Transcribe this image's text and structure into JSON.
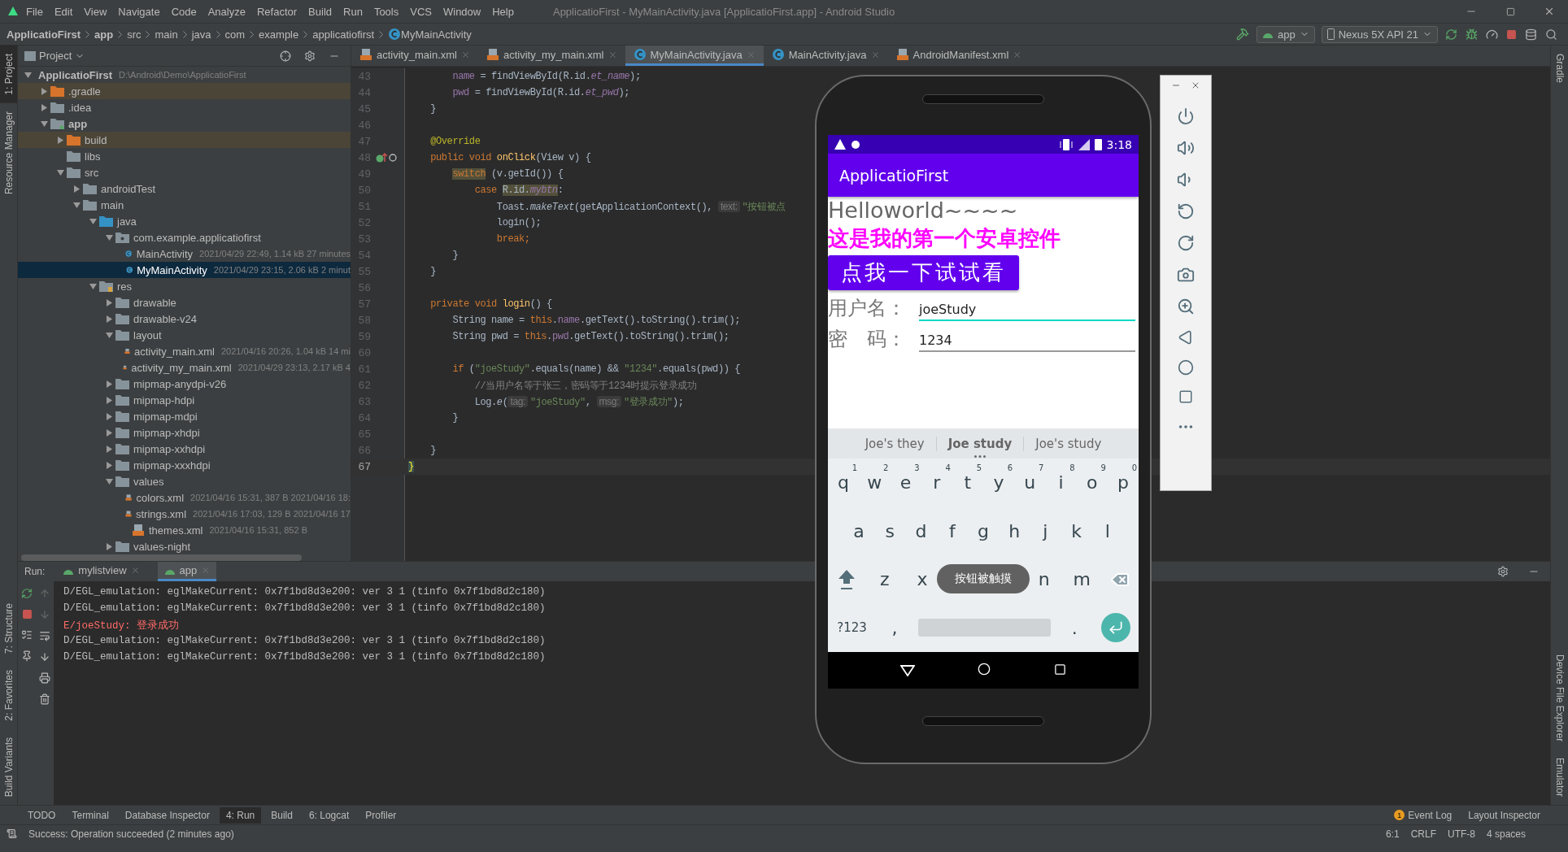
{
  "window": {
    "title": "ApplicatioFirst - MyMainActivity.java [ApplicatioFirst.app] - Android Studio"
  },
  "menu": [
    "File",
    "Edit",
    "View",
    "Navigate",
    "Code",
    "Analyze",
    "Refactor",
    "Build",
    "Run",
    "Tools",
    "VCS",
    "Window",
    "Help"
  ],
  "breadcrumb": [
    {
      "label": "ApplicatioFirst",
      "kind": "project"
    },
    {
      "label": "app",
      "kind": "module"
    },
    {
      "label": "src",
      "kind": "dir"
    },
    {
      "label": "main",
      "kind": "dir"
    },
    {
      "label": "java",
      "kind": "dir"
    },
    {
      "label": "com",
      "kind": "dir"
    },
    {
      "label": "example",
      "kind": "dir"
    },
    {
      "label": "applicatiofirst",
      "kind": "dir"
    },
    {
      "label": "MyMainActivity",
      "kind": "class"
    }
  ],
  "toolbar": {
    "run_config": "app",
    "device": "Nexus 5X API 21"
  },
  "left_stripe": {
    "top": [
      {
        "label": "1: Project",
        "selected": true
      },
      {
        "label": "Resource Manager",
        "selected": false
      }
    ],
    "bottom": [
      {
        "label": "7: Structure",
        "selected": false
      },
      {
        "label": "2: Favorites",
        "selected": false
      },
      {
        "label": "Build Variants",
        "selected": false
      }
    ]
  },
  "right_stripe": {
    "top": [
      {
        "label": "Gradle"
      }
    ],
    "bottom": [
      {
        "label": "Device File Explorer"
      },
      {
        "label": "Emulator"
      }
    ]
  },
  "project": {
    "title": "Project",
    "tree": [
      {
        "label": "ApplicatioFirst",
        "kind": "project",
        "meta": "D:\\Android\\Demo\\ApplicatioFirst",
        "expanded": true,
        "selected": false,
        "children": [
          {
            "label": ".gradle",
            "kind": "excluded",
            "expanded": false,
            "selected": false
          },
          {
            "label": ".idea",
            "kind": "folder",
            "expanded": false,
            "selected": false
          },
          {
            "label": "app",
            "kind": "module",
            "expanded": true,
            "selected": false,
            "children": [
              {
                "label": "build",
                "kind": "excluded",
                "expanded": false,
                "selected": false
              },
              {
                "label": "libs",
                "kind": "folder",
                "selected": false
              },
              {
                "label": "src",
                "kind": "folder",
                "expanded": true,
                "selected": false,
                "children": [
                  {
                    "label": "androidTest",
                    "kind": "folder",
                    "expanded": false,
                    "selected": false
                  },
                  {
                    "label": "main",
                    "kind": "folder",
                    "expanded": true,
                    "selected": false,
                    "children": [
                      {
                        "label": "java",
                        "kind": "source",
                        "expanded": true,
                        "selected": false,
                        "children": [
                          {
                            "label": "com.example.applicatiofirst",
                            "kind": "package",
                            "expanded": true,
                            "selected": false,
                            "children": [
                              {
                                "label": "MainActivity",
                                "kind": "class",
                                "meta": "2021/04/29 22:49, 1.14 kB 27 minutes",
                                "selected": false
                              },
                              {
                                "label": "MyMainActivity",
                                "kind": "class",
                                "meta": "2021/04/29 23:15, 2.06 kB 2 minut",
                                "selected": true
                              }
                            ]
                          }
                        ]
                      },
                      {
                        "label": "res",
                        "kind": "resources",
                        "expanded": true,
                        "selected": false,
                        "children": [
                          {
                            "label": "drawable",
                            "kind": "folder",
                            "expanded": false,
                            "selected": false
                          },
                          {
                            "label": "drawable-v24",
                            "kind": "folder",
                            "expanded": false,
                            "selected": false
                          },
                          {
                            "label": "layout",
                            "kind": "folder",
                            "expanded": true,
                            "selected": false,
                            "children": [
                              {
                                "label": "activity_main.xml",
                                "kind": "xml",
                                "meta": "2021/04/16 20:26, 1.04 kB 14 mi",
                                "selected": false
                              },
                              {
                                "label": "activity_my_main.xml",
                                "kind": "xml",
                                "meta": "2021/04/29 23:13, 2.17 kB 4",
                                "selected": false
                              }
                            ]
                          },
                          {
                            "label": "mipmap-anydpi-v26",
                            "kind": "folder",
                            "expanded": false,
                            "selected": false
                          },
                          {
                            "label": "mipmap-hdpi",
                            "kind": "folder",
                            "expanded": false,
                            "selected": false
                          },
                          {
                            "label": "mipmap-mdpi",
                            "kind": "folder",
                            "expanded": false,
                            "selected": false
                          },
                          {
                            "label": "mipmap-xhdpi",
                            "kind": "folder",
                            "expanded": false,
                            "selected": false
                          },
                          {
                            "label": "mipmap-xxhdpi",
                            "kind": "folder",
                            "expanded": false,
                            "selected": false
                          },
                          {
                            "label": "mipmap-xxxhdpi",
                            "kind": "folder",
                            "expanded": false,
                            "selected": false
                          },
                          {
                            "label": "values",
                            "kind": "folder",
                            "expanded": true,
                            "selected": false,
                            "children": [
                              {
                                "label": "colors.xml",
                                "kind": "xml",
                                "meta": "2021/04/16 15:31, 387 B 2021/04/16 18:",
                                "selected": false
                              },
                              {
                                "label": "strings.xml",
                                "kind": "xml",
                                "meta": "2021/04/16 17:03, 129 B 2021/04/16 17",
                                "selected": false
                              },
                              {
                                "label": "themes.xml",
                                "kind": "xml",
                                "meta": "2021/04/16 15:31, 852 B",
                                "selected": false
                              }
                            ]
                          },
                          {
                            "label": "values-night",
                            "kind": "folder",
                            "expanded": false,
                            "selected": false
                          }
                        ]
                      }
                    ]
                  }
                ]
              }
            ]
          }
        ]
      }
    ]
  },
  "editor_tabs": [
    {
      "label": "activity_main.xml",
      "kind": "xml",
      "selected": false
    },
    {
      "label": "activity_my_main.xml",
      "kind": "xml",
      "selected": false
    },
    {
      "label": "MyMainActivity.java",
      "kind": "class",
      "selected": true
    },
    {
      "label": "MainActivity.java",
      "kind": "class",
      "selected": false
    },
    {
      "label": "AndroidManifest.xml",
      "kind": "manifest",
      "selected": false
    }
  ],
  "code": [
    {
      "number": "43",
      "current": false,
      "tokens": [
        {
          "kind": "f",
          "text": "        name"
        },
        {
          "kind": "p",
          "text": " = findViewById(R.id."
        },
        {
          "kind": "fi",
          "text": "et_name"
        },
        {
          "kind": "p",
          "text": ");"
        }
      ]
    },
    {
      "number": "44",
      "current": false,
      "tokens": [
        {
          "kind": "f",
          "text": "        pwd"
        },
        {
          "kind": "p",
          "text": " = findViewById(R.id."
        },
        {
          "kind": "fi",
          "text": "et_pwd"
        },
        {
          "kind": "p",
          "text": ");"
        }
      ]
    },
    {
      "number": "45",
      "current": false,
      "tokens": [
        {
          "kind": "p",
          "text": "    }"
        }
      ]
    },
    {
      "number": "46",
      "current": false
    },
    {
      "number": "47",
      "current": false,
      "tokens": [
        {
          "kind": "a",
          "text": "    @Override"
        }
      ]
    },
    {
      "number": "48",
      "current": false,
      "override_mark": true,
      "tokens": [
        {
          "kind": "k",
          "text": "    public void "
        },
        {
          "kind": "m",
          "text": "onClick"
        },
        {
          "kind": "p",
          "text": "(View v) {"
        }
      ]
    },
    {
      "number": "49",
      "current": false,
      "tokens": [
        {
          "kind": "hk",
          "text": "        switch"
        },
        {
          "kind": "p",
          "text": " (v.getId()) {"
        }
      ]
    },
    {
      "number": "50",
      "current": false,
      "tokens": [
        {
          "kind": "k",
          "text": "            case "
        },
        {
          "kind": "hp",
          "text": "R.id."
        },
        {
          "kind": "hf",
          "text": "mybtn"
        },
        {
          "kind": "p",
          "text": ":"
        }
      ]
    },
    {
      "number": "51",
      "current": false,
      "tokens": [
        {
          "kind": "p",
          "text": "                Toast."
        },
        {
          "kind": "i",
          "text": "makeText"
        },
        {
          "kind": "p",
          "text": "(getApplicationContext(), "
        },
        {
          "kind": "h",
          "text": "text:"
        },
        {
          "kind": "s",
          "text": "\"按钮被点"
        }
      ]
    },
    {
      "number": "52",
      "current": false,
      "tokens": [
        {
          "kind": "p",
          "text": "                login();"
        }
      ]
    },
    {
      "number": "53",
      "current": false,
      "tokens": [
        {
          "kind": "k",
          "text": "                break;"
        }
      ]
    },
    {
      "number": "54",
      "current": false,
      "tokens": [
        {
          "kind": "p",
          "text": "        }"
        }
      ]
    },
    {
      "number": "55",
      "current": false,
      "tokens": [
        {
          "kind": "p",
          "text": "    }"
        }
      ]
    },
    {
      "number": "56",
      "current": false
    },
    {
      "number": "57",
      "current": false,
      "tokens": [
        {
          "kind": "k",
          "text": "    private void "
        },
        {
          "kind": "m",
          "text": "login"
        },
        {
          "kind": "p",
          "text": "() {"
        }
      ]
    },
    {
      "number": "58",
      "current": false,
      "tokens": [
        {
          "kind": "p",
          "text": "        String name = "
        },
        {
          "kind": "k",
          "text": "this"
        },
        {
          "kind": "p",
          "text": "."
        },
        {
          "kind": "f",
          "text": "name"
        },
        {
          "kind": "p",
          "text": ".getText().toString().trim();"
        }
      ]
    },
    {
      "number": "59",
      "current": false,
      "tokens": [
        {
          "kind": "p",
          "text": "        String pwd = "
        },
        {
          "kind": "k",
          "text": "this"
        },
        {
          "kind": "p",
          "text": "."
        },
        {
          "kind": "f",
          "text": "pwd"
        },
        {
          "kind": "p",
          "text": ".getText().toString().trim();"
        }
      ]
    },
    {
      "number": "60",
      "current": false
    },
    {
      "number": "61",
      "current": false,
      "tokens": [
        {
          "kind": "k",
          "text": "        if "
        },
        {
          "kind": "p",
          "text": "("
        },
        {
          "kind": "s",
          "text": "\"joeStudy\""
        },
        {
          "kind": "p",
          "text": ".equals(name) && "
        },
        {
          "kind": "s",
          "text": "\"1234\""
        },
        {
          "kind": "p",
          "text": ".equals(pwd)) {"
        }
      ]
    },
    {
      "number": "62",
      "current": false,
      "tokens": [
        {
          "kind": "c",
          "text": "            //当用户名等于张三，密码等于1234时提示登录成功"
        }
      ]
    },
    {
      "number": "63",
      "current": false,
      "tokens": [
        {
          "kind": "p",
          "text": "            Log."
        },
        {
          "kind": "i",
          "text": "e"
        },
        {
          "kind": "p",
          "text": "("
        },
        {
          "kind": "h",
          "text": "tag:"
        },
        {
          "kind": "s",
          "text": "\"joeStudy\""
        },
        {
          "kind": "p",
          "text": ", "
        },
        {
          "kind": "h",
          "text": "msg:"
        },
        {
          "kind": "s",
          "text": "\"登录成功\""
        },
        {
          "kind": "p",
          "text": ");"
        }
      ]
    },
    {
      "number": "64",
      "current": false,
      "tokens": [
        {
          "kind": "p",
          "text": "        }"
        }
      ]
    },
    {
      "number": "65",
      "current": false
    },
    {
      "number": "66",
      "current": false,
      "tokens": [
        {
          "kind": "p",
          "text": "    }"
        }
      ]
    },
    {
      "number": "67",
      "current": true,
      "tokens": [
        {
          "kind": "y",
          "text": "}"
        }
      ]
    }
  ],
  "phone": {
    "time": "3:18",
    "app_title": "ApplicatioFirst",
    "hello": "Helloworld~~~~",
    "subtitle": "这是我的第一个安卓控件",
    "button": "点我一下试试看",
    "fields": [
      {
        "label": "用户名：",
        "value": "joeStudy",
        "focused": true
      },
      {
        "label": "密　码：",
        "value": "1234",
        "focused": false
      }
    ],
    "suggestions": [
      {
        "text": "Joe's they",
        "selected": false
      },
      {
        "text": "Joe study",
        "selected": true
      },
      {
        "text": "Joe's study",
        "selected": false
      }
    ],
    "keyboard": [
      [
        {
          "kind": "letter",
          "label": "q",
          "hint": "1"
        },
        {
          "kind": "letter",
          "label": "w",
          "hint": "2"
        },
        {
          "kind": "letter",
          "label": "e",
          "hint": "3"
        },
        {
          "kind": "letter",
          "label": "r",
          "hint": "4"
        },
        {
          "kind": "letter",
          "label": "t",
          "hint": "5"
        },
        {
          "kind": "letter",
          "label": "y",
          "hint": "6"
        },
        {
          "kind": "letter",
          "label": "u",
          "hint": "7"
        },
        {
          "kind": "letter",
          "label": "i",
          "hint": "8"
        },
        {
          "kind": "letter",
          "label": "o",
          "hint": "9"
        },
        {
          "kind": "letter",
          "label": "p",
          "hint": "0"
        }
      ],
      [
        {
          "kind": "letter",
          "label": "a"
        },
        {
          "kind": "letter",
          "label": "s"
        },
        {
          "kind": "letter",
          "label": "d"
        },
        {
          "kind": "letter",
          "label": "f"
        },
        {
          "kind": "letter",
          "label": "g"
        },
        {
          "kind": "letter",
          "label": "h"
        },
        {
          "kind": "letter",
          "label": "j"
        },
        {
          "kind": "letter",
          "label": "k"
        },
        {
          "kind": "letter",
          "label": "l"
        }
      ],
      [
        {
          "kind": "shift"
        },
        {
          "kind": "letter",
          "label": "z"
        },
        {
          "kind": "letter",
          "label": "x"
        },
        {
          "kind": "gap"
        },
        {
          "kind": "gap"
        },
        {
          "kind": "gap"
        },
        {
          "kind": "letter",
          "label": "n"
        },
        {
          "kind": "letter",
          "label": "m"
        },
        {
          "kind": "backspace"
        }
      ],
      [
        {
          "kind": "symbols",
          "label": "?123"
        },
        {
          "kind": "letter",
          "label": ","
        },
        {
          "kind": "space"
        },
        {
          "kind": "letter",
          "label": "."
        },
        {
          "kind": "enter"
        }
      ]
    ],
    "toast": "按钮被触摸"
  },
  "run": {
    "title": "Run:",
    "tabs": [
      {
        "label": "mylistview",
        "selected": false
      },
      {
        "label": "app",
        "selected": true
      }
    ],
    "log": [
      {
        "kind": "debug",
        "text": "D/EGL_emulation: eglMakeCurrent: 0x7f1bd8d3e200: ver 3 1 (tinfo 0x7f1bd8d2c180)"
      },
      {
        "kind": "debug",
        "text": "D/EGL_emulation: eglMakeCurrent: 0x7f1bd8d3e200: ver 3 1 (tinfo 0x7f1bd8d2c180)"
      },
      {
        "kind": "error",
        "text": "E/joeStudy: 登录成功"
      },
      {
        "kind": "debug",
        "text": "D/EGL_emulation: eglMakeCurrent: 0x7f1bd8d3e200: ver 3 1 (tinfo 0x7f1bd8d2c180)"
      },
      {
        "kind": "debug",
        "text": "D/EGL_emulation: eglMakeCurrent: 0x7f1bd8d3e200: ver 3 1 (tinfo 0x7f1bd8d2c180)"
      }
    ]
  },
  "tool_tabs": [
    {
      "label": "TODO",
      "selected": false
    },
    {
      "label": "Terminal",
      "selected": false
    },
    {
      "label": "Database Inspector",
      "selected": false
    },
    {
      "label": "4: Run",
      "selected": true
    },
    {
      "label": "Build",
      "selected": false
    },
    {
      "label": "6: Logcat",
      "selected": false
    },
    {
      "label": "Profiler",
      "selected": false
    }
  ],
  "tool_tabs_right": [
    {
      "label": "Event Log",
      "badge": "1"
    },
    {
      "label": "Layout Inspector"
    }
  ],
  "status_bar": {
    "message": "Success: Operation succeeded (2 minutes ago)",
    "items": [
      "6:1",
      "CRLF",
      "UTF-8",
      "4 spaces"
    ]
  }
}
